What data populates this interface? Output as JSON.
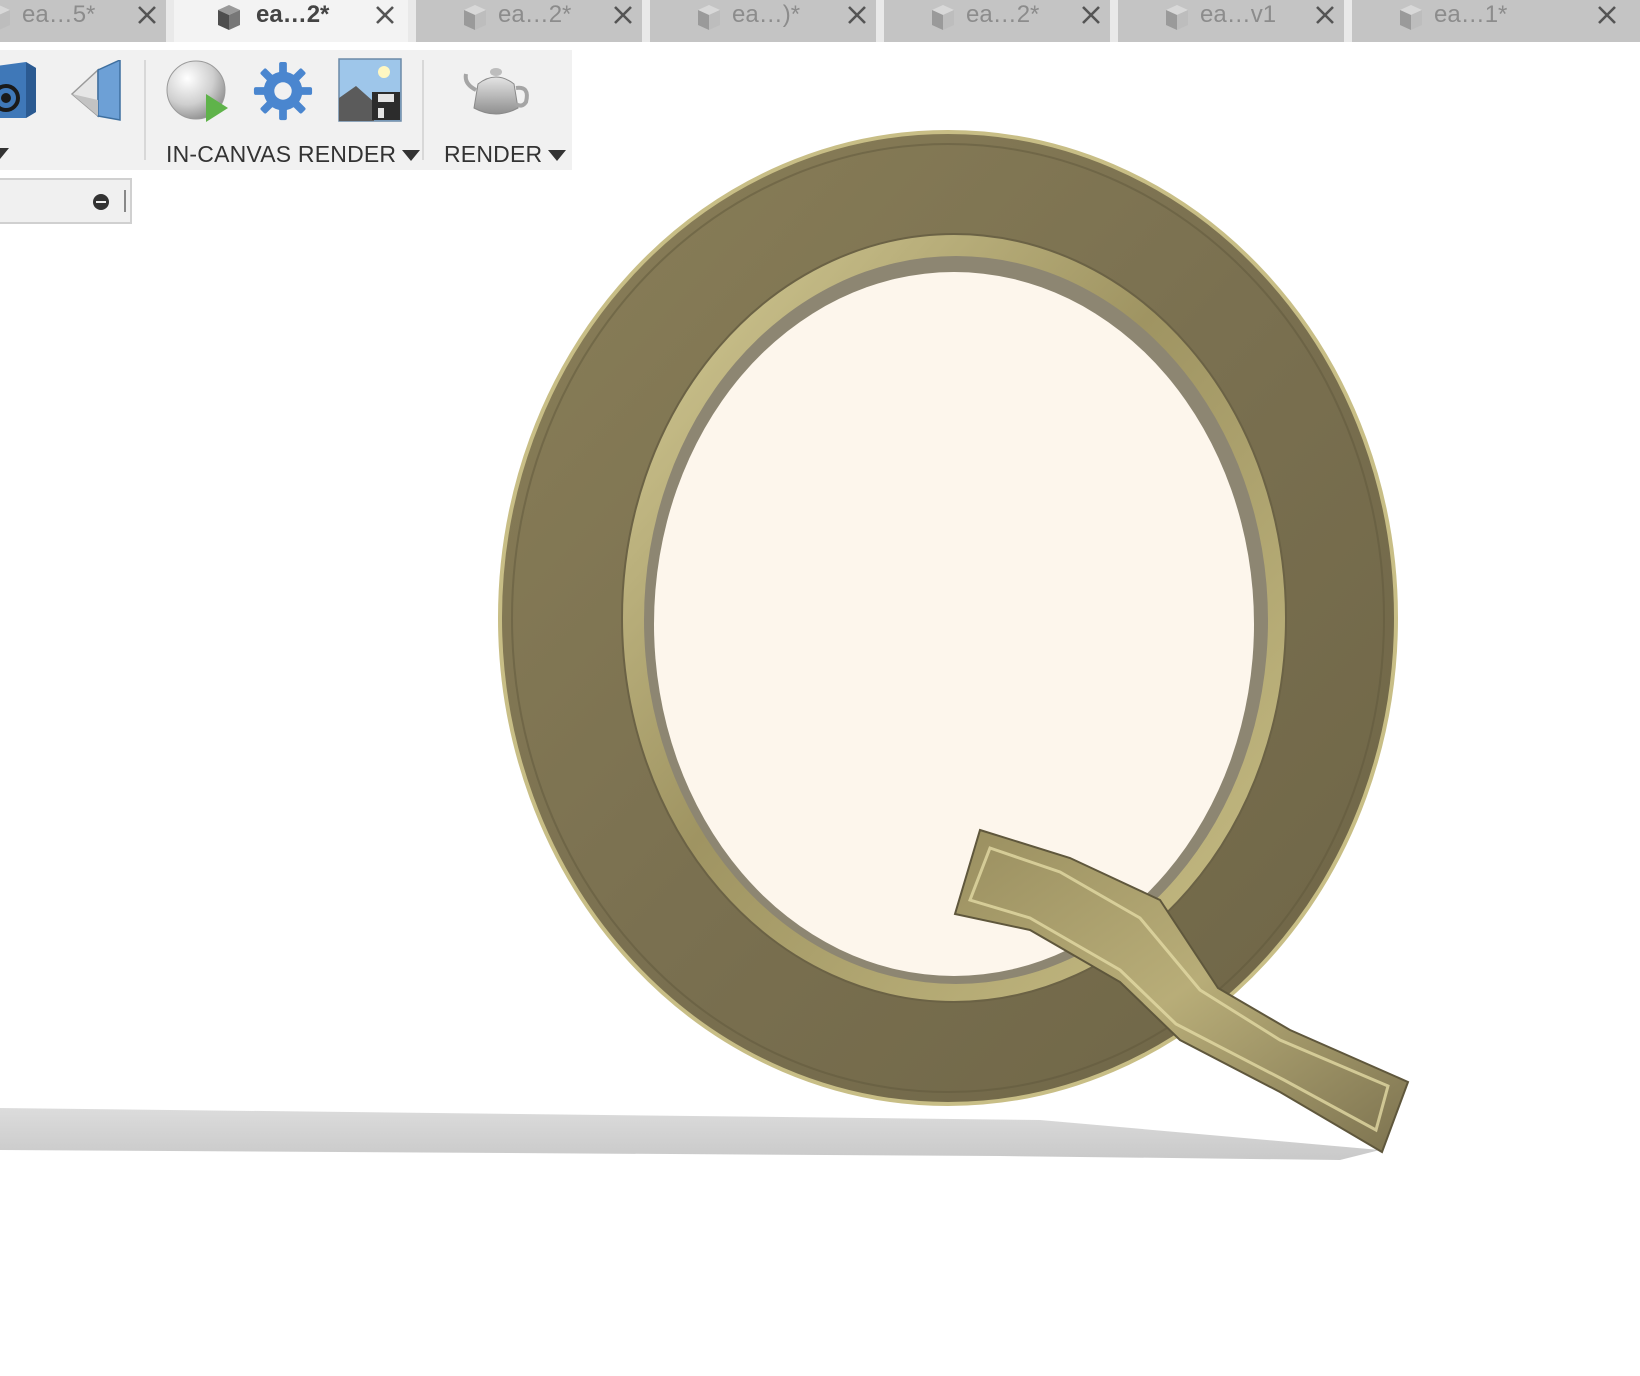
{
  "tabs": [
    {
      "title": "ea…5*",
      "active": false
    },
    {
      "title": "ea…2*",
      "active": true
    },
    {
      "title": "ea…2*",
      "active": false
    },
    {
      "title": "ea…)*",
      "active": false
    },
    {
      "title": "ea…2*",
      "active": false
    },
    {
      "title": "ea…v1",
      "active": false
    },
    {
      "title": "ea…1*",
      "active": false
    }
  ],
  "toolbar": {
    "in_canvas_render_label": "IN-CANVAS RENDER",
    "render_label": "RENDER"
  },
  "colors": {
    "tab_bar": "#c4c4c4",
    "active_tab": "#f3f3f3",
    "toolbar": "#f1f1f1",
    "model_gold": "#7d7350",
    "model_highlight": "#d9cf98",
    "model_face": "#fdf6ec",
    "ground_shadow": "#cfcfcf"
  },
  "icons": {
    "tab_document": "cube-icon",
    "tab_close": "close-icon",
    "appearance": "appearance-cube-icon",
    "scene": "scene-settings-icon",
    "in_canvas_render": "render-play-icon",
    "settings": "gear-icon",
    "capture": "capture-image-icon",
    "render": "teapot-icon",
    "panel_collapse": "minus-circle-icon"
  }
}
